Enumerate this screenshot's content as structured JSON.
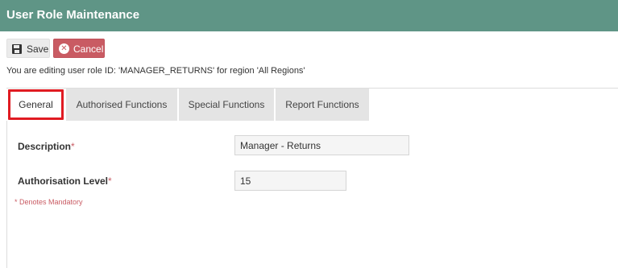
{
  "header": {
    "title": "User Role Maintenance"
  },
  "toolbar": {
    "save_label": "Save",
    "cancel_label": "Cancel",
    "cancel_icon_glyph": "✕"
  },
  "info": {
    "editing_text": "You are editing user role ID: 'MANAGER_RETURNS' for region 'All Regions'"
  },
  "tabs": [
    {
      "label": "General",
      "active": true
    },
    {
      "label": "Authorised Functions",
      "active": false
    },
    {
      "label": "Special Functions",
      "active": false
    },
    {
      "label": "Report Functions",
      "active": false
    }
  ],
  "form": {
    "description": {
      "label": "Description",
      "required_marker": "*",
      "value": "Manager - Returns"
    },
    "authorisation_level": {
      "label": "Authorisation Level",
      "required_marker": "*",
      "value": "15"
    },
    "mandatory_note": "* Denotes Mandatory"
  },
  "colors": {
    "header_bg": "#5f9586",
    "cancel_bg": "#c95b63",
    "active_tab_highlight": "#e01b22",
    "required_marker": "#c95b63"
  }
}
